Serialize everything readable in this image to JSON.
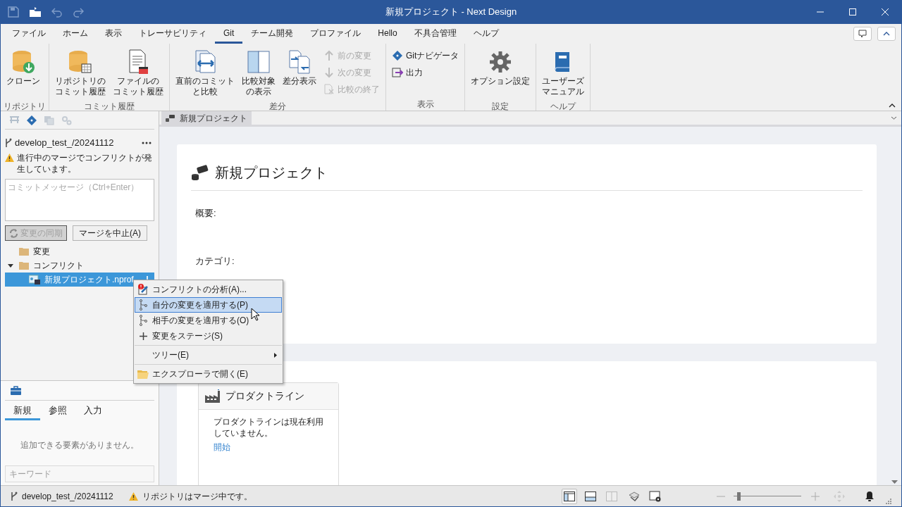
{
  "window": {
    "title": "新規プロジェクト - Next Design"
  },
  "ribbon_tabs": [
    {
      "label": "ファイル",
      "selected": false
    },
    {
      "label": "ホーム",
      "selected": false
    },
    {
      "label": "表示",
      "selected": false
    },
    {
      "label": "トレーサビリティ",
      "selected": false
    },
    {
      "label": "Git",
      "selected": true
    },
    {
      "label": "チーム開発",
      "selected": false
    },
    {
      "label": "プロファイル",
      "selected": false
    },
    {
      "label": "Hello",
      "selected": false
    },
    {
      "label": "不具合管理",
      "selected": false
    },
    {
      "label": "ヘルプ",
      "selected": false
    }
  ],
  "ribbon_groups": [
    {
      "label": "リポジトリ",
      "buttons": [
        {
          "kind": "large",
          "label": "クローン"
        }
      ]
    },
    {
      "label": "コミット履歴",
      "buttons": [
        {
          "kind": "large",
          "lines": [
            "リポジトリの",
            "コミット履歴"
          ]
        },
        {
          "kind": "large",
          "lines": [
            "ファイルの",
            "コミット履歴"
          ]
        }
      ]
    },
    {
      "label": "差分",
      "buttons": [
        {
          "kind": "large",
          "lines": [
            "直前のコミット",
            "と比較"
          ]
        },
        {
          "kind": "large",
          "lines": [
            "比較対象",
            "の表示"
          ]
        },
        {
          "kind": "large",
          "label": "差分表示"
        },
        {
          "kind": "small",
          "label": "前の変更",
          "disabled": true
        },
        {
          "kind": "small",
          "label": "次の変更",
          "disabled": true
        },
        {
          "kind": "small",
          "label": "比較の終了",
          "disabled": true
        }
      ]
    },
    {
      "label": "表示",
      "buttons": [
        {
          "kind": "small",
          "label": "Gitナビゲータ",
          "disabled": false
        },
        {
          "kind": "small",
          "label": "出力",
          "disabled": false
        }
      ]
    },
    {
      "label": "設定",
      "buttons": [
        {
          "kind": "large",
          "label": "オプション設定"
        }
      ]
    },
    {
      "label": "ヘルプ",
      "buttons": [
        {
          "kind": "large",
          "lines": [
            "ユーザーズ",
            "マニュアル"
          ]
        }
      ]
    }
  ],
  "git_panel": {
    "branch": "develop_test_/20241112",
    "warning": "進行中のマージでコンフリクトが発生しています。",
    "commit_message": {
      "placeholder": "コミットメッセージ（Ctrl+Enter）"
    },
    "buttons": [
      {
        "label": "変更の同期",
        "disabled": true
      },
      {
        "label": "マージを中止(A)",
        "disabled": false
      }
    ],
    "tree": [
      {
        "label": "変更",
        "selected": false
      },
      {
        "label": "コンフリクト",
        "selected": false,
        "expanded": true,
        "children": [
          {
            "label": "新規プロジェクト.nprof",
            "selected": true,
            "badge": "!"
          }
        ]
      }
    ]
  },
  "context_menu": [
    {
      "kind": "item",
      "label": "コンフリクトの分析(A)...",
      "selected": false
    },
    {
      "kind": "item",
      "label": "自分の変更を適用する(P)",
      "selected": true
    },
    {
      "kind": "item",
      "label": "相手の変更を適用する(O)",
      "selected": false
    },
    {
      "kind": "item",
      "label": "変更をステージ(S)",
      "selected": false
    },
    {
      "kind": "separator"
    },
    {
      "kind": "submenu",
      "label": "ツリー(E)",
      "selected": false
    },
    {
      "kind": "separator"
    },
    {
      "kind": "item",
      "label": "エクスプローラで開く(E)",
      "selected": false
    }
  ],
  "toolbox": {
    "tabs": [
      {
        "label": "新規",
        "selected": true
      },
      {
        "label": "参照",
        "selected": false
      },
      {
        "label": "入力",
        "selected": false
      }
    ],
    "empty_message": "追加できる要素がありません。",
    "search": {
      "placeholder": "キーワード"
    }
  },
  "document_tabs": [
    {
      "label": "新規プロジェクト",
      "selected": true
    }
  ],
  "project_card": {
    "title": "新規プロジェクト",
    "fields": [
      "概要:",
      "カテゴリ:"
    ]
  },
  "product_line_card": {
    "title": "プロダクトライン",
    "message": "プロダクトラインは現在利用していません。",
    "link": "開始"
  },
  "status_bar": {
    "branch": "develop_test_/20241112",
    "message": "リポジトリはマージ中です。",
    "layouts": [
      {
        "selected": true
      },
      {
        "selected": false
      },
      {
        "selected": false
      }
    ],
    "zoom": {
      "level": 0.05
    }
  }
}
